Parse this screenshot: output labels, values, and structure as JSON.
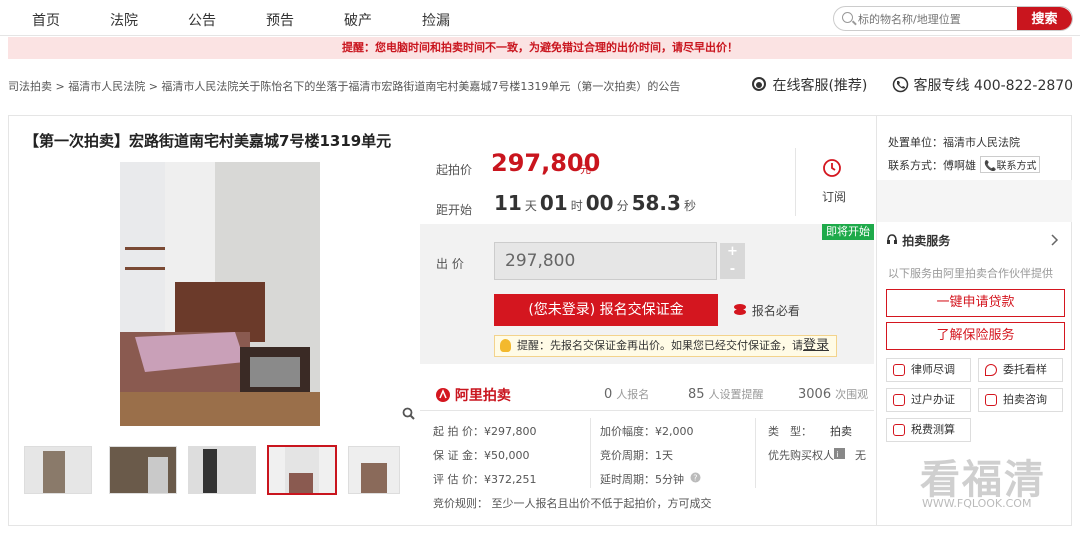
{
  "nav": [
    "首页",
    "法院",
    "公告",
    "预告",
    "破产",
    "捡漏"
  ],
  "search": {
    "placeholder": "标的物名称/地理位置",
    "button": "搜索"
  },
  "notice": "提醒：您电脑时间和拍卖时间不一致，为避免错过合理的出价时间，请尽早出价！",
  "breadcrumb": "司法拍卖 > 福清市人民法院 > 福清市人民法院关于陈怡名下的坐落于福清市宏路街道南宅村美嘉城7号楼1319单元（第一次拍卖）的公告",
  "service": {
    "online": "在线客服(推荐)",
    "hotline_label": "客服专线",
    "hotline": "400-822-2870"
  },
  "lot": {
    "title": "【第一次拍卖】宏路街道南宅村美嘉城7号楼1319单元"
  },
  "price": {
    "start_label": "起拍价",
    "start_value": "297,800",
    "unit": "元",
    "countdown_label": "距开始",
    "days": "11",
    "day_unit": "天",
    "hours": "01",
    "hour_unit": "时",
    "minutes": "00",
    "minute_unit": "分",
    "seconds": "58.3",
    "second_unit": "秒",
    "remind": "订阅"
  },
  "bid": {
    "badge": "即将开始",
    "label": "出 价",
    "value": "297,800",
    "plus": "+",
    "minus": "-",
    "register_button": "(您未登录) 报名交保证金",
    "must_read": "报名必看",
    "tip": "提醒：先报名交保证金再出价。如果您已经交付保证金，请",
    "tip_link": "登录"
  },
  "auction_info": {
    "brand": "阿里拍卖",
    "apply_count": "0",
    "apply_unit": "人报名",
    "remind_count": "85",
    "remind_unit": "人设置提醒",
    "view_count": "3006",
    "view_unit": "次围观"
  },
  "details": {
    "start_price": "起 拍 价：¥297,800",
    "deposit": "保 证 金：¥50,000",
    "estimate": "评 估 价：¥372,251",
    "increment": "加价幅度：¥2,000",
    "period": "竞价周期：1天",
    "delay": "延时周期：5分钟",
    "type_label": "类　型：",
    "type_value": "拍卖",
    "priority": "优先购买权人",
    "priority_value": "无",
    "rule": "竞价规则：  至少一人报名且出价不低于起拍价，方可成交"
  },
  "right": {
    "unit_label": "处置单位：",
    "unit_value": "福清市人民法院",
    "contact_label": "联系方式：傅啊雄",
    "contact_tag": "联系方式",
    "services_title": "拍卖服务",
    "services_sub": "以下服务由阿里拍卖合作伙伴提供",
    "loan_button": "一键申请贷款",
    "insurance_button": "了解保险服务",
    "svc": [
      "律师尽调",
      "委托看样",
      "过户办证",
      "拍卖咨询",
      "税费测算"
    ]
  },
  "watermark": {
    "title": "看福清",
    "url": "WWW.FQLOOK.COM"
  },
  "colors": {
    "brand_red": "#c9151e",
    "badge_green": "#1eaa4a"
  }
}
